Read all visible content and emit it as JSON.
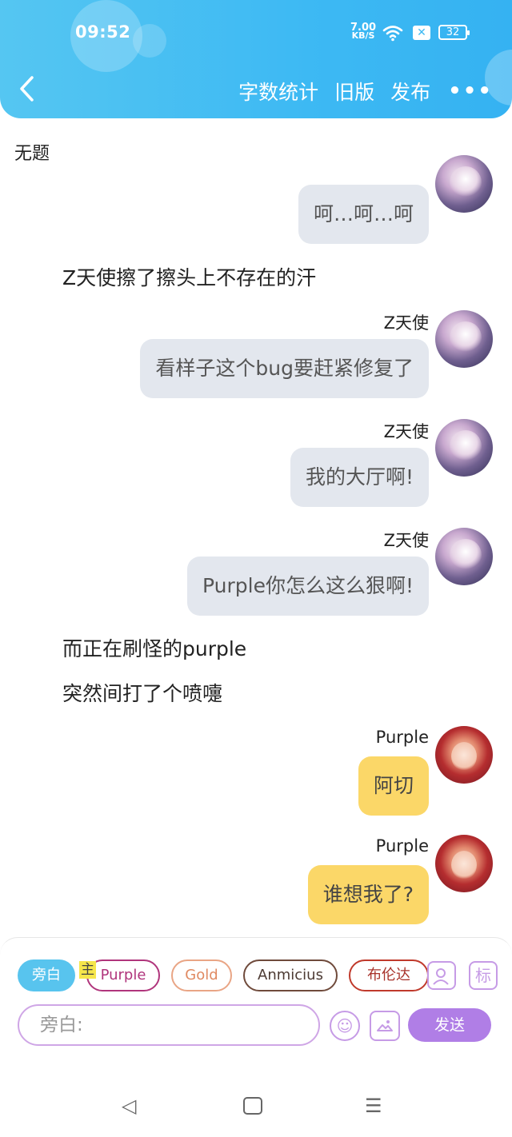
{
  "status_bar": {
    "time": "09:52",
    "net_speed_value": "7.00",
    "net_speed_unit": "KB/S",
    "battery": "32",
    "wifi_icon": "wifi-icon",
    "notif_icon": "x-icon"
  },
  "header": {
    "back_icon": "chevron-left-icon",
    "actions": {
      "word_count": "字数统计",
      "old_version": "旧版",
      "publish": "发布"
    },
    "more_icon": "more-dots-icon",
    "accent": "#3db9f3"
  },
  "doc_title": "无题",
  "chat": {
    "msg1": {
      "text": "呵…呵…呵"
    },
    "narr1": "Z天使擦了擦头上不存在的汗",
    "msg2": {
      "speaker": "Z天使",
      "text": "看样子这个bug要赶紧修复了"
    },
    "msg3": {
      "speaker": "Z天使",
      "text": "我的大厅啊!"
    },
    "msg4": {
      "speaker": "Z天使",
      "text": "Purple你怎么这么狠啊!"
    },
    "narr2": "而正在刷怪的purple",
    "narr3": "突然间打了个喷嚏",
    "msg5": {
      "speaker": "Purple",
      "text": "阿切"
    },
    "msg6": {
      "speaker": "Purple",
      "text": "谁想我了?"
    }
  },
  "composer": {
    "roles": {
      "narrator": "旁白",
      "main_badge": "主",
      "purple": "Purple",
      "gold": "Gold",
      "anmicius": "Anmicius",
      "bulunda": "布伦达"
    },
    "user_icon": "user-card-icon",
    "mark_label": "标",
    "input_placeholder": "旁白:",
    "emoji_icon": "emoji-icon",
    "image_icon": "image-icon",
    "send_label": "发送",
    "send_color": "#b07ee6"
  },
  "system_nav": {
    "back": "◁",
    "menu": "☰"
  }
}
